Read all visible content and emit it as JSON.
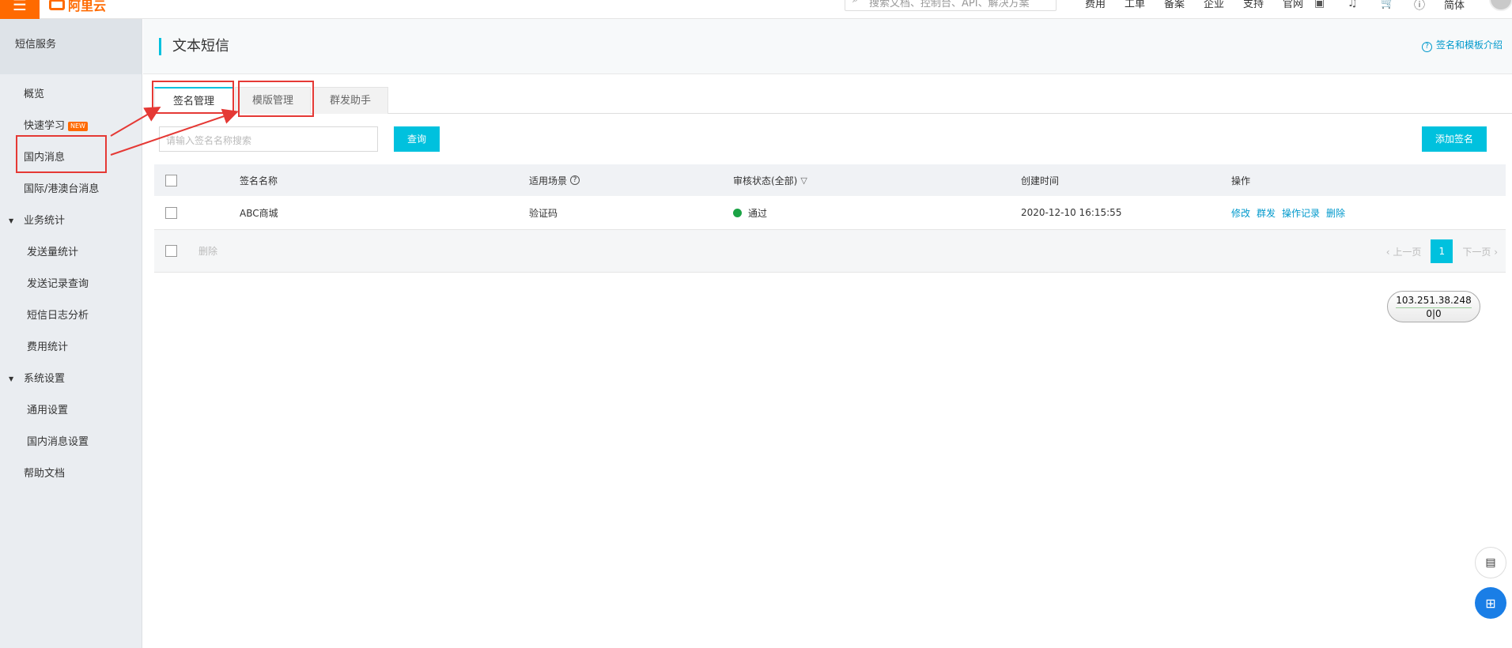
{
  "topbar": {
    "menu_icon": "☰",
    "logo_text": "阿里云",
    "search_placeholder": "搜索文档、控制台、API、解决方案",
    "nav": [
      "费用",
      "工单",
      "备案",
      "企业",
      "支持",
      "官网"
    ],
    "icons": [
      "screen-icon",
      "bell-icon",
      "cart-icon",
      "help-icon"
    ],
    "lang": "简体"
  },
  "sidebar": {
    "title": "短信服务",
    "items": [
      {
        "label": "概览"
      },
      {
        "label": "快速学习",
        "badge": "NEW"
      },
      {
        "label": "国内消息"
      },
      {
        "label": "国际/港澳台消息"
      }
    ],
    "group_business": {
      "label": "业务统计",
      "items": [
        "发送量统计",
        "发送记录查询",
        "短信日志分析",
        "费用统计"
      ]
    },
    "group_system": {
      "label": "系统设置",
      "items": [
        "通用设置",
        "国内消息设置"
      ]
    },
    "help": "帮助文档"
  },
  "page": {
    "title": "文本短信",
    "help_link": "签名和模板介绍"
  },
  "tabs": [
    "签名管理",
    "模版管理",
    "群发助手"
  ],
  "toolbar": {
    "search_placeholder": "请输入签名名称搜索",
    "query_label": "查询",
    "add_label": "添加签名"
  },
  "table": {
    "headers": {
      "name": "签名名称",
      "scene": "适用场景",
      "status": "审核状态(全部)",
      "created": "创建时间",
      "ops": "操作"
    },
    "rows": [
      {
        "name": "ABC商城",
        "scene": "验证码",
        "status": "通过",
        "created": "2020-12-10 16:15:55",
        "ops": [
          "修改",
          "群发",
          "操作记录",
          "删除"
        ]
      }
    ],
    "footer": {
      "delete_label": "删除",
      "prev": "上一页",
      "page": "1",
      "next": "下一页"
    }
  },
  "ip_widget": {
    "ip": "103.251.38.248",
    "left": "0",
    "right": "0"
  },
  "colors": {
    "accent": "#00c1de",
    "brand": "#ff6a00",
    "status_ok": "#1ba345",
    "annotation": "#e53935"
  }
}
